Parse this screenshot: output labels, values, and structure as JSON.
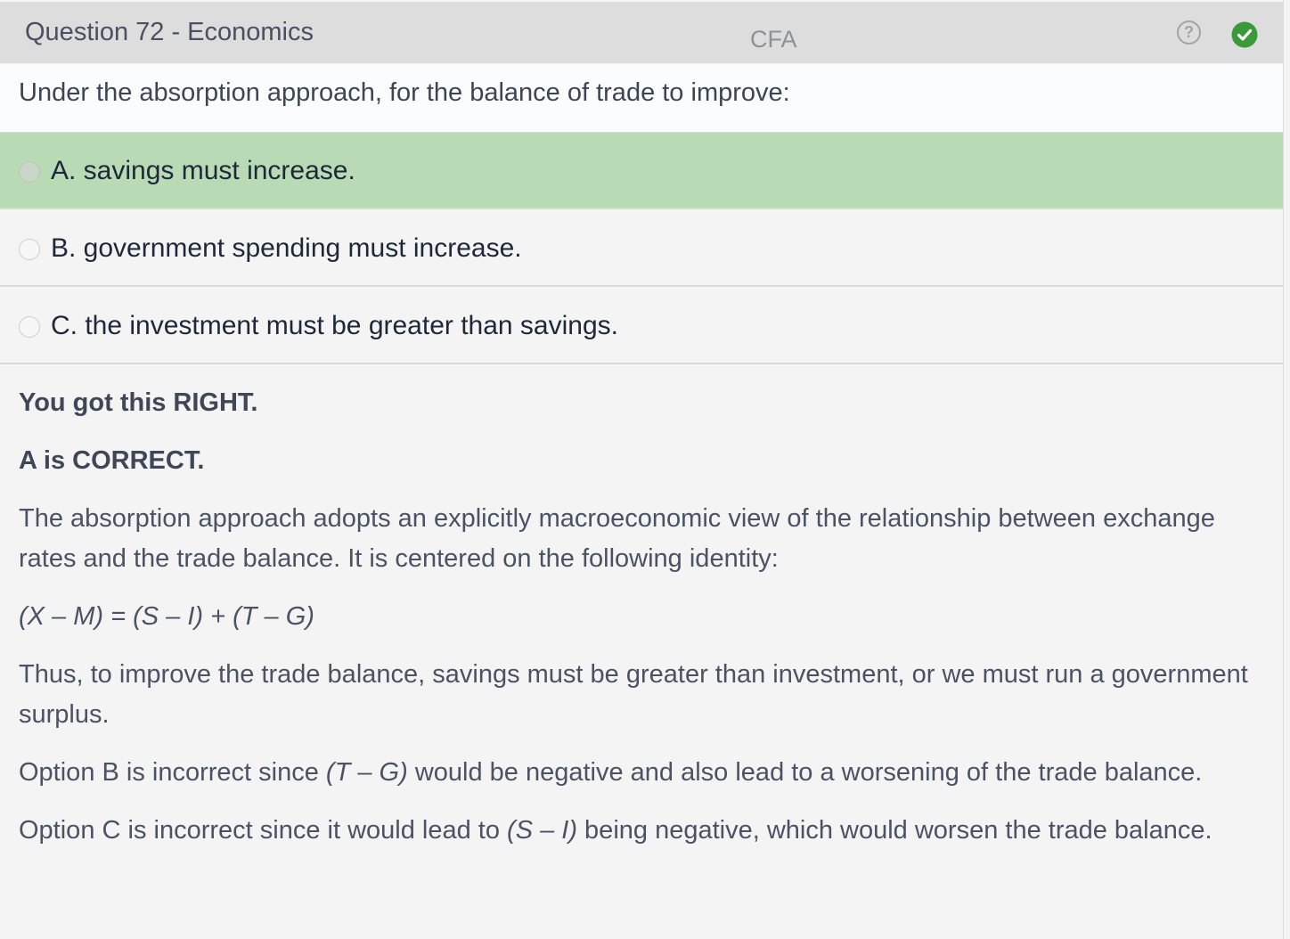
{
  "header": {
    "title": "Question 72 - Economics",
    "exam": "CFA",
    "help_icon": "help-circle-icon",
    "status_icon": "check-circle-icon",
    "status_color": "#3a9a3a"
  },
  "question": {
    "text": "Under the absorption approach, for the balance of trade to improve:"
  },
  "options": [
    {
      "label": "A. savings must increase.",
      "selected": true
    },
    {
      "label": "B. government spending must increase.",
      "selected": false
    },
    {
      "label": "C. the investment must be greater than savings.",
      "selected": false
    }
  ],
  "explanation": {
    "result": "You got this RIGHT.",
    "verdict": "A is CORRECT.",
    "intro": "The absorption approach adopts an explicitly macroeconomic view of the relationship between exchange rates and the trade balance.  It is centered on the following identity:",
    "formula": "(X – M) = (S – I) + (T – G)",
    "thus": "Thus, to improve the trade balance, savings must be greater than investment, or we must run a government surplus.",
    "option_b_pre": "Option B is incorrect since ",
    "option_b_term": "(T – G)",
    "option_b_post": " would be negative and also lead to a worsening of the trade balance.",
    "option_c_pre": "Option C is incorrect since it would lead to ",
    "option_c_term": "(S – I)",
    "option_c_post": " being negative, which would worsen the trade balance."
  },
  "colors": {
    "selected_option_bg": "#b8dab5",
    "header_bg": "#dddddd"
  }
}
